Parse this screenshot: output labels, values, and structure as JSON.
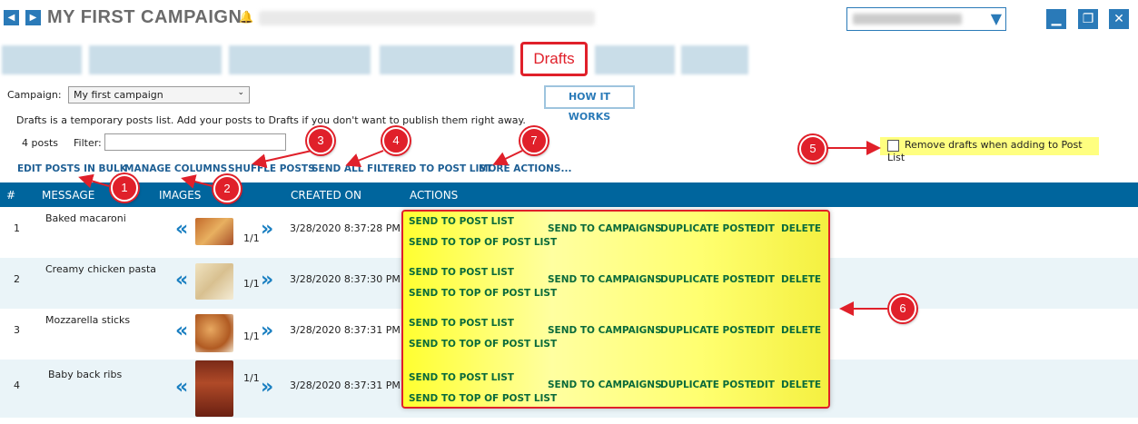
{
  "header": {
    "title": "MY FIRST CAMPAIGN",
    "prev_icon": "triangle-left",
    "next_icon": "triangle-right"
  },
  "window_buttons": [
    "minimize",
    "restore",
    "close"
  ],
  "tabs": {
    "active": "Drafts"
  },
  "controls": {
    "campaign_label": "Campaign:",
    "campaign_value": "My first campaign",
    "how_it_works": "HOW IT WORKS",
    "description": "Drafts is a temporary posts list. Add your posts to Drafts if you don't want to publish them right away.",
    "count": "4 posts",
    "filter_label": "Filter:",
    "filter_value": "",
    "remove_drafts": "Remove drafts when adding to Post List"
  },
  "toolbar": {
    "edit_bulk": "EDIT POSTS IN BULK",
    "manage_columns": "MANAGE COLUMNS",
    "shuffle": "SHUFFLE POSTS",
    "send_all": "SEND ALL FILTERED TO POST LIST",
    "more_actions": "MORE ACTIONS..."
  },
  "table": {
    "headers": [
      "#",
      "MESSAGE",
      "IMAGES",
      "CREATED ON",
      "ACTIONS"
    ],
    "rows": [
      {
        "num": "1",
        "message": "Baked macaroni",
        "images": "1/1",
        "created": "3/28/2020 8:37:28 PM"
      },
      {
        "num": "2",
        "message": "Creamy chicken pasta",
        "images": "1/1",
        "created": "3/28/2020 8:37:30 PM"
      },
      {
        "num": "3",
        "message": "Mozzarella sticks",
        "images": "1/1",
        "created": "3/28/2020 8:37:31 PM"
      },
      {
        "num": "4",
        "message": "Baby back ribs",
        "images": "1/1",
        "created": "3/28/2020 8:37:31 PM"
      }
    ],
    "actions": {
      "send_post_list": "SEND TO POST LIST",
      "send_top": "SEND TO TOP OF POST LIST",
      "send_campaigns": "SEND TO CAMPAIGNS",
      "duplicate": "DUPLICATE POST",
      "edit": "EDIT",
      "delete": "DELETE"
    }
  },
  "callouts": [
    "1",
    "2",
    "3",
    "4",
    "5",
    "6",
    "7"
  ],
  "colors": {
    "accent": "#00659d",
    "callout": "#e0202a",
    "highlight": "#ffff80"
  }
}
